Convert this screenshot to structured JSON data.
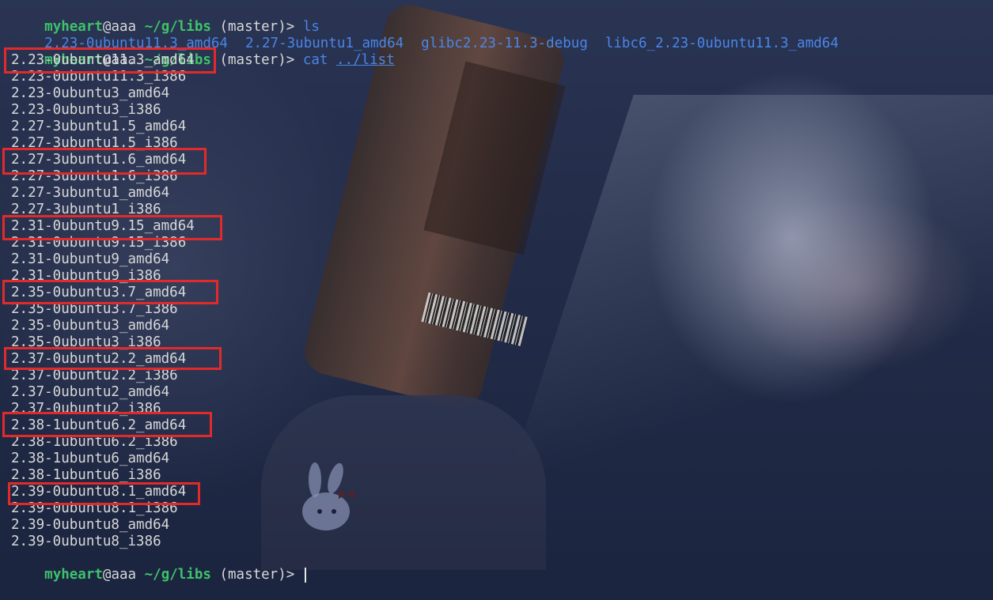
{
  "prompt": {
    "user": "myheart",
    "host": "@aaa",
    "path": "~/g/libs",
    "branch": "(master)>",
    "cursor_symbol": "|"
  },
  "commands": {
    "ls": "ls",
    "cat": "cat",
    "cat_arg": "../list"
  },
  "ls_output": [
    "2.23-0ubuntu11.3_amd64",
    "2.27-3ubuntu1_amd64",
    "glibc2.23-11.3-debug",
    "libc6_2.23-0ubuntu11.3_amd64"
  ],
  "list_output": [
    "2.23-0ubuntu11.3_amd64",
    "2.23-0ubuntu11.3_i386",
    "2.23-0ubuntu3_amd64",
    "2.23-0ubuntu3_i386",
    "2.27-3ubuntu1.5_amd64",
    "2.27-3ubuntu1.5_i386",
    "2.27-3ubuntu1.6_amd64",
    "2.27-3ubuntu1.6_i386",
    "2.27-3ubuntu1_amd64",
    "2.27-3ubuntu1_i386",
    "2.31-0ubuntu9.15_amd64",
    "2.31-0ubuntu9.15_i386",
    "2.31-0ubuntu9_amd64",
    "2.31-0ubuntu9_i386",
    "2.35-0ubuntu3.7_amd64",
    "2.35-0ubuntu3.7_i386",
    "2.35-0ubuntu3_amd64",
    "2.35-0ubuntu3_i386",
    "2.37-0ubuntu2.2_amd64",
    "2.37-0ubuntu2.2_i386",
    "2.37-0ubuntu2_amd64",
    "2.37-0ubuntu2_i386",
    "2.38-1ubuntu6.2_amd64",
    "2.38-1ubuntu6.2_i386",
    "2.38-1ubuntu6_amd64",
    "2.38-1ubuntu6_i386",
    "2.39-0ubuntu8.1_amd64",
    "2.39-0ubuntu8.1_i386",
    "2.39-0ubuntu8_amd64",
    "2.39-0ubuntu8_i386"
  ],
  "highlighted_entries": [
    "2.23-0ubuntu11.3_amd64",
    "2.27-3ubuntu1.6_amd64",
    "2.31-0ubuntu9.15_amd64",
    "2.35-0ubuntu3.7_amd64",
    "2.37-0ubuntu2.2_amd64",
    "2.38-1ubuntu6.2_amd64",
    "2.39-0ubuntu8.1_amd64"
  ],
  "colors": {
    "prompt_green": "#3ec26a",
    "command_blue": "#4a86e8",
    "text": "#d8d8d8",
    "highlight_red": "#e32a2a"
  }
}
